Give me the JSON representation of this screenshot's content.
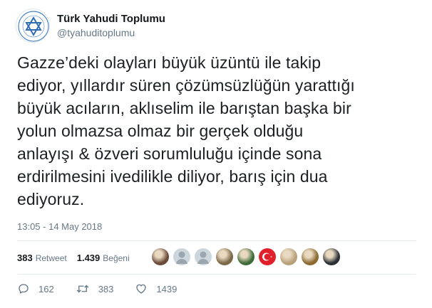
{
  "author": {
    "display_name": "Türk Yahudi Toplumu",
    "handle": "@tyahuditoplumu"
  },
  "tweet": {
    "lines": [
      "Gazze’deki olayları büyük üzüntü ile takip",
      "ediyor, yıllardır süren çözümsüzlüğün yarattığı",
      "büyük acıların, aklıselim ile barıştan başka bir",
      "yolun olmazsa olmaz bir gerçek olduğu",
      "anlayışı & özveri sorumluluğu içinde sona",
      "erdirilmesini ivedilikle diliyor, barış için dua",
      "ediyoruz."
    ],
    "timestamp": "13:05 - 14 May 2018"
  },
  "stats": {
    "retweets": "383",
    "retweets_label": "Retweet",
    "likes": "1.439",
    "likes_label": "Beğeni"
  },
  "likers": [
    {
      "icon": "avatar-photo",
      "color": "#6b4a3a"
    },
    {
      "icon": "default-avatar",
      "color": "#9aa5ae"
    },
    {
      "icon": "default-avatar",
      "color": "#9aa5ae"
    },
    {
      "icon": "avatar-photo",
      "color": "#7a6848"
    },
    {
      "icon": "avatar-photo",
      "color": "#3f6b3a"
    },
    {
      "icon": "turkish-flag-avatar",
      "color": "#e0202a"
    },
    {
      "icon": "avatar-photo",
      "color": "#b8a07a"
    },
    {
      "icon": "avatar-photo",
      "color": "#8c6a32"
    },
    {
      "icon": "avatar-photo",
      "color": "#2a2f35"
    }
  ],
  "actions": {
    "replies": "162",
    "retweets": "383",
    "likes": "1439"
  }
}
